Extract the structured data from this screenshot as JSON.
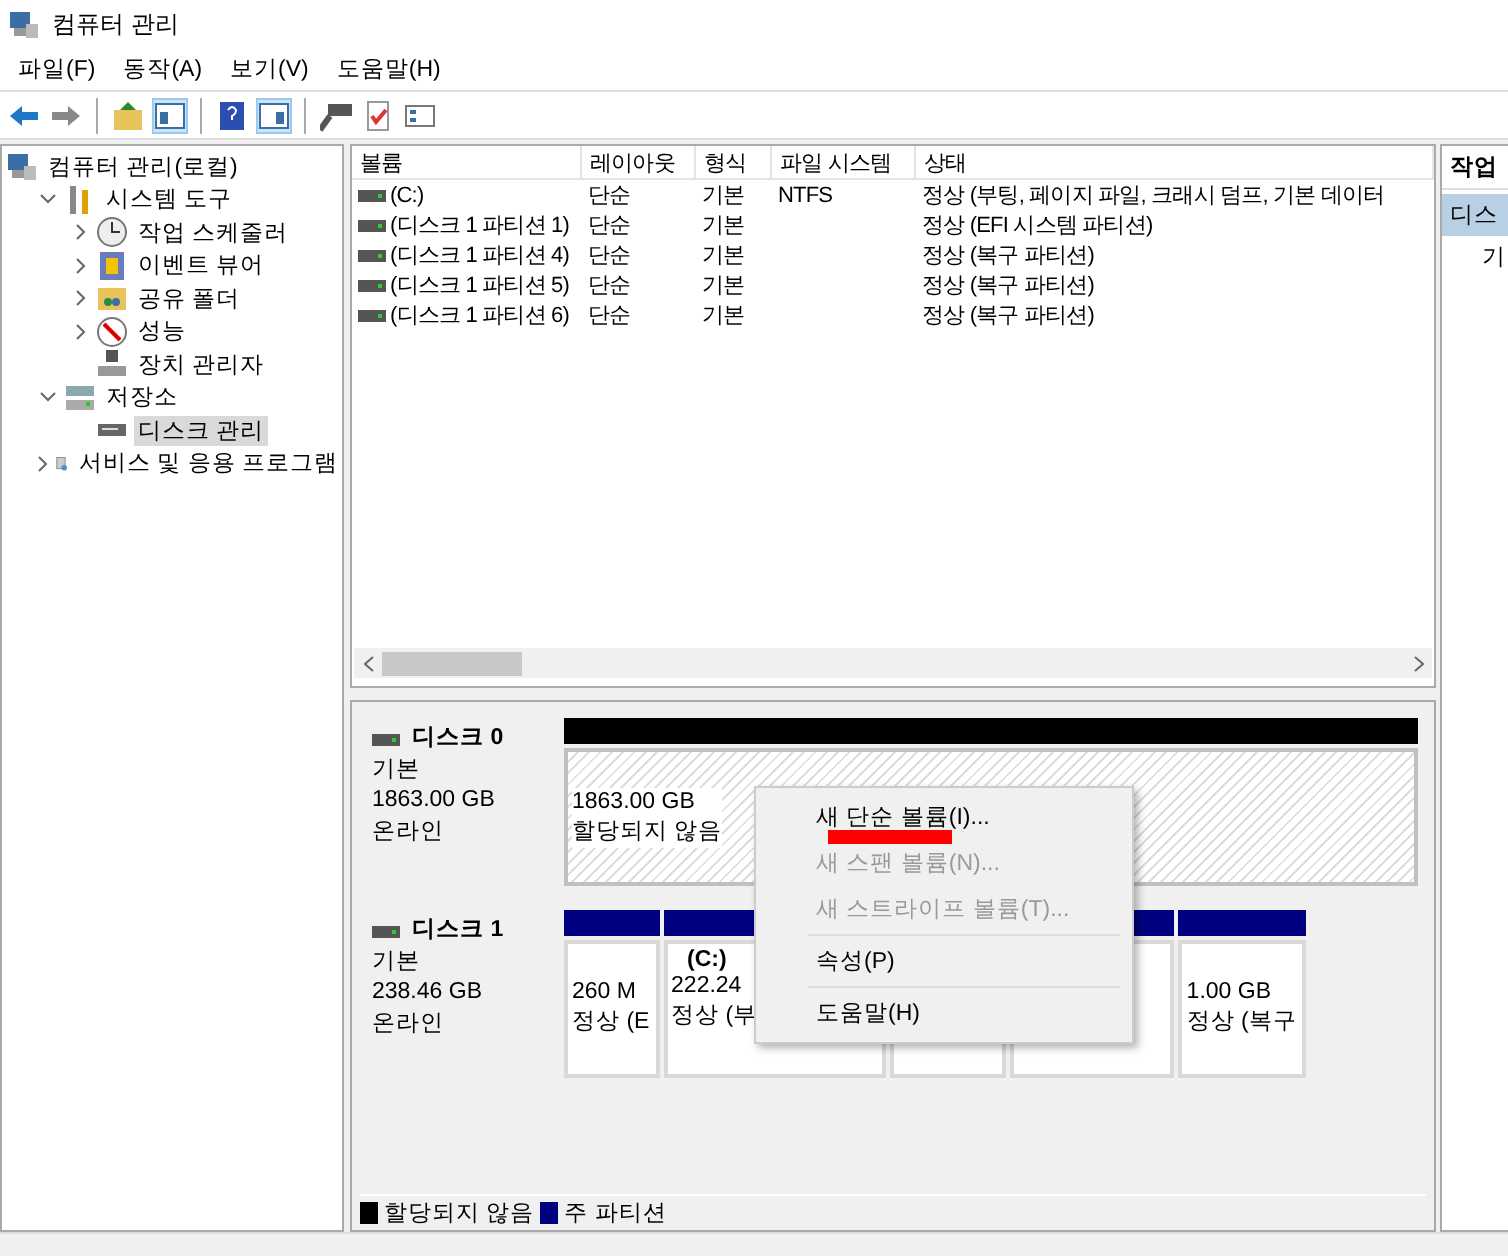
{
  "window": {
    "title": "컴퓨터 관리"
  },
  "menu_bar": [
    "파일(F)",
    "동작(A)",
    "보기(V)",
    "도움말(H)"
  ],
  "toolbar": [
    {
      "selected": false
    },
    {
      "selected": false
    },
    {
      "selected": false
    },
    {
      "selected": true
    },
    {
      "selected": false
    },
    {
      "selected": true
    },
    {
      "selected": false
    },
    {
      "selected": false
    },
    {
      "selected": false
    }
  ],
  "tree": [
    {
      "label": "컴퓨터 관리(로컬)",
      "selected": false,
      "children": [
        {
          "label": "시스템 도구",
          "expandable": true,
          "expanded": true,
          "selected": false,
          "children": [
            {
              "label": "작업 스케줄러",
              "expandable": true,
              "expanded": false,
              "selected": false
            },
            {
              "label": "이벤트 뷰어",
              "expandable": true,
              "expanded": false,
              "selected": false
            },
            {
              "label": "공유 폴더",
              "expandable": true,
              "expanded": false,
              "selected": false
            },
            {
              "label": "성능",
              "expandable": true,
              "expanded": false,
              "selected": false
            },
            {
              "label": "장치 관리자",
              "expandable": false,
              "selected": false
            }
          ]
        },
        {
          "label": "저장소",
          "expandable": true,
          "expanded": true,
          "selected": false,
          "children": [
            {
              "label": "디스크 관리",
              "expandable": false,
              "selected": true
            }
          ]
        },
        {
          "label": "서비스 및 응용 프로그램",
          "expandable": true,
          "expanded": false,
          "selected": false
        }
      ]
    }
  ],
  "table": {
    "columns": [
      "볼륨",
      "레이아웃",
      "형식",
      "파일 시스템",
      "상태"
    ],
    "rows": [
      [
        "(C:)",
        "단순",
        "기본",
        "NTFS",
        "정상 (부팅, 페이지 파일, 크래시 덤프, 기본 데이터"
      ],
      [
        "(디스크 1 파티션 1)",
        "단순",
        "기본",
        "",
        "정상 (EFI 시스템 파티션)"
      ],
      [
        "(디스크 1 파티션 4)",
        "단순",
        "기본",
        "",
        "정상 (복구 파티션)"
      ],
      [
        "(디스크 1 파티션 5)",
        "단순",
        "기본",
        "",
        "정상 (복구 파티션)"
      ],
      [
        "(디스크 1 파티션 6)",
        "단순",
        "기본",
        "",
        "정상 (복구 파티션)"
      ]
    ]
  },
  "disks": [
    {
      "name": "디스크 0",
      "type": "기본",
      "size": "1863.00 GB",
      "status": "온라인",
      "partitions": [
        {
          "kind": "unallocated",
          "lines": [
            "1863.00 GB",
            "할당되지 않음"
          ]
        }
      ]
    },
    {
      "name": "디스크 1",
      "type": "기본",
      "size": "238.46 GB",
      "status": "온라인",
      "partitions": [
        {
          "kind": "primary",
          "lines": [
            "260 M",
            "정상 (E"
          ]
        },
        {
          "kind": "primary",
          "label": "(C:)",
          "lines": [
            "222.24",
            "정상 (부"
          ]
        },
        {
          "kind": "primary"
        },
        {
          "kind": "primary"
        },
        {
          "kind": "primary",
          "lines": [
            "1.00 GB",
            "정상 (복구"
          ]
        }
      ]
    }
  ],
  "context_menu": [
    {
      "kind": "item",
      "label": "새 단순 볼륨(I)...",
      "disabled": false,
      "marked": true
    },
    {
      "kind": "item",
      "label": "새 스팬 볼륨(N)...",
      "disabled": true,
      "marked": false
    },
    {
      "kind": "item",
      "label": "새 스트라이프 볼륨(T)...",
      "disabled": true,
      "marked": false
    },
    {
      "kind": "separator"
    },
    {
      "kind": "item",
      "label": "속성(P)",
      "disabled": false,
      "marked": false
    },
    {
      "kind": "separator"
    },
    {
      "kind": "item",
      "label": "도움말(H)",
      "disabled": false,
      "marked": false
    }
  ],
  "legend": [
    {
      "label": "할당되지 않음",
      "color": "#000000"
    },
    {
      "label": "주 파티션",
      "color": "#000080"
    }
  ],
  "actions": {
    "title": "작업",
    "section": "디스",
    "item": "기"
  }
}
